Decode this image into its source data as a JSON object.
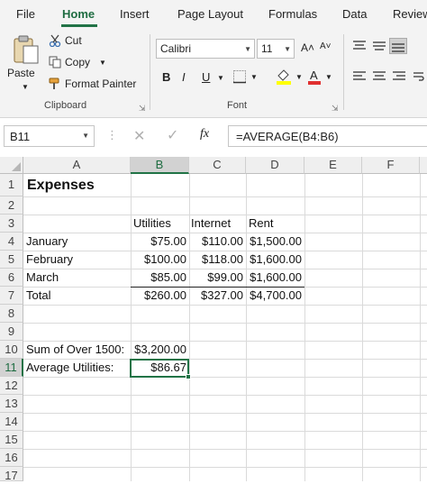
{
  "tabs": [
    "File",
    "Home",
    "Insert",
    "Page Layout",
    "Formulas",
    "Data",
    "Review"
  ],
  "ribbon": {
    "clipboard": {
      "paste": "Paste",
      "cut": "Cut",
      "copy": "Copy",
      "format_painter": "Format Painter",
      "label": "Clipboard"
    },
    "font": {
      "name": "Calibri",
      "size": "11",
      "grow": "A˄",
      "shrink": "A˅",
      "bold": "B",
      "italic": "I",
      "underline": "U",
      "label": "Font",
      "fill_color": "#ffff00",
      "font_color": "#e03030"
    }
  },
  "formula_bar": {
    "name_box": "B11",
    "fx": "fx",
    "formula": "=AVERAGE(B4:B6)"
  },
  "columns": [
    "A",
    "B",
    "C",
    "D",
    "E",
    "F"
  ],
  "rows": [
    "1",
    "2",
    "3",
    "4",
    "5",
    "6",
    "7",
    "8",
    "9",
    "10",
    "11",
    "12",
    "13",
    "14",
    "15",
    "16",
    "17"
  ],
  "cells": {
    "a1": "Expenses",
    "b3": "Utilities",
    "c3": "Internet",
    "d3": "Rent",
    "a4": "January",
    "b4": "$75.00",
    "c4": "$110.00",
    "d4": "$1,500.00",
    "a5": "February",
    "b5": "$100.00",
    "c5": "$118.00",
    "d5": "$1,600.00",
    "a6": "March",
    "b6": "$85.00",
    "c6": "$99.00",
    "d6": "$1,600.00",
    "a7": "Total",
    "b7": "$260.00",
    "c7": "$327.00",
    "d7": "$4,700.00",
    "a10": "Sum of Over 1500:",
    "b10": "$3,200.00",
    "a11": "Average Utilities:",
    "b11": "$86.67"
  },
  "colors": {
    "accent": "#217346",
    "selection": "#1e6c41"
  }
}
